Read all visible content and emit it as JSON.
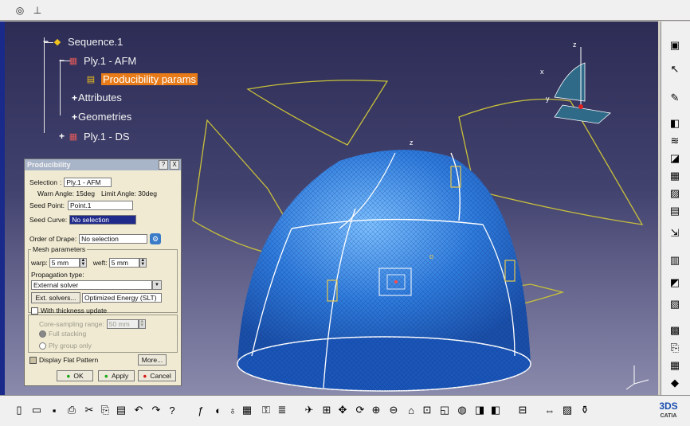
{
  "app": {
    "brand": "CATIA",
    "logo_text": "3DS"
  },
  "tree": {
    "nodes": [
      {
        "label": "Sequence.1"
      },
      {
        "label": "Ply.1 - AFM"
      },
      {
        "label": "Producibility params"
      },
      {
        "label": "Attributes"
      },
      {
        "label": "Geometries"
      },
      {
        "label": "Ply.1 - DS"
      }
    ]
  },
  "dialog": {
    "title": "Producibility",
    "help_btn": "?",
    "close_btn": "X",
    "selection_label": "Selection",
    "selection_value": "Ply.1 - AFM",
    "warn_angle": "Warn Angle: 15deg",
    "limit_angle": "Limit Angle: 30deg",
    "seed_point_label": "Seed Point:",
    "seed_point_value": "Point.1",
    "seed_curve_label": "Seed Curve:",
    "seed_curve_value": "No selection",
    "order_label": "Order of Drape:",
    "order_value": "No selection",
    "mesh_group": "Mesh parameters",
    "warp_label": "warp:",
    "warp_value": "5 mm",
    "weft_label": "weft:",
    "weft_value": "5 mm",
    "propagation_label": "Propagation type:",
    "propagation_value": "External solver",
    "ext_solvers_btn": "Ext. solvers...",
    "solver_value": "Optimized Energy (SLT)",
    "thickness_label": "With thickness update",
    "core_label": "Core-sampling range:",
    "core_value": "50 mm",
    "full_stacking": "Full stacking",
    "ply_group_only": "Ply group only",
    "flat_pattern_label": "Display Flat Pattern",
    "more_btn": "More...",
    "ok_btn": "OK",
    "apply_btn": "Apply",
    "cancel_btn": "Cancel"
  },
  "viewport": {
    "axis_z": "z",
    "axis_x": "x",
    "axis_y": "y"
  },
  "colors": {
    "accent": "#e87a18",
    "dome": "#2e7bdc",
    "outline": "#c8c03a"
  }
}
